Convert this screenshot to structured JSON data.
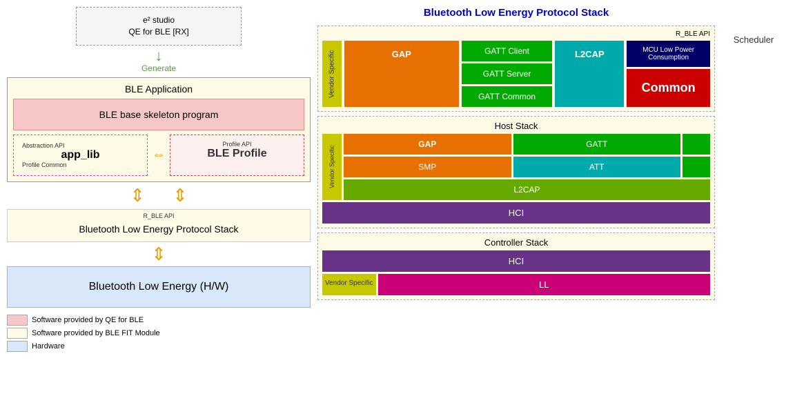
{
  "left": {
    "e2studio_line1": "e² studio",
    "e2studio_line2": "QE for BLE [RX]",
    "generate": "Generate",
    "ble_application": "BLE Application",
    "ble_skeleton": "BLE base skeleton program",
    "abstraction_api": "Abstraction API",
    "app_lib": "app_lib",
    "profile_common": "Profile Common",
    "arrow_symbol": "⇔",
    "profile_api": "Profile API",
    "ble_profile": "BLE Profile",
    "rble_api_label": "R_BLE API",
    "protocol_stack": "Bluetooth Low Energy Protocol Stack",
    "ble_hw": "Bluetooth Low Energy (H/W)",
    "legend": [
      {
        "label": "Software provided by QE for BLE",
        "color": "#f8c8c8"
      },
      {
        "label": "Software provided by BLE FIT Module",
        "color": "#fffbe6"
      },
      {
        "label": "Hardware",
        "color": "#d8e8f8"
      }
    ]
  },
  "right": {
    "title": "Bluetooth Low Energy Protocol Stack",
    "rble_api": {
      "label": "R_BLE API",
      "vendor_specific": "Vendor Specific",
      "gap": "GAP",
      "gatt_client": "GATT Client",
      "gatt_server": "GATT Server",
      "gatt_common": "GATT Common",
      "l2cap": "L2CAP",
      "mcu_low_power": "MCU Low Power Consumption",
      "common": "Common"
    },
    "host_stack": {
      "title": "Host Stack",
      "vendor_specific": "Vendor Specific",
      "gap": "GAP",
      "gatt": "GATT",
      "smp": "SMP",
      "att": "ATT",
      "l2cap": "L2CAP",
      "hci": "HCI"
    },
    "controller_stack": {
      "title": "Controller Stack",
      "hci": "HCI",
      "vendor_specific": "Vendor Specific",
      "ll": "LL"
    },
    "scheduler": "Scheduler"
  }
}
